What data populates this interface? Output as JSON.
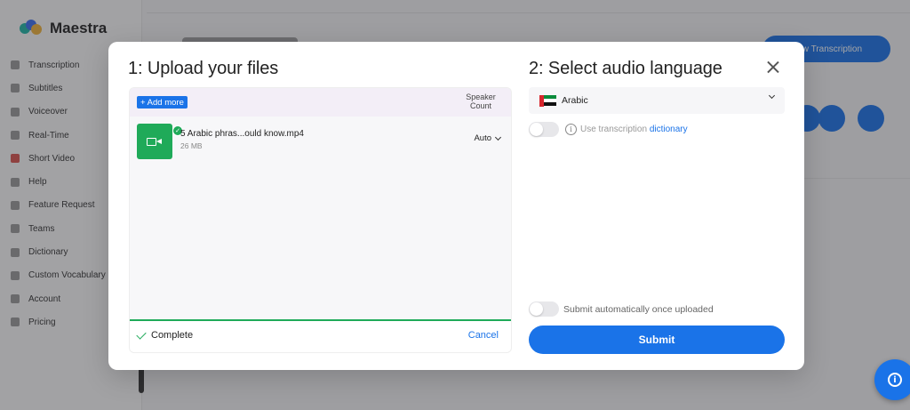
{
  "background": {
    "app_name": "Maestra",
    "nav_items": [
      "Transcription",
      "Subtitles",
      "Voiceover",
      "Real-Time",
      "Short Video",
      "Help",
      "Feature Request",
      "Teams",
      "Dictionary",
      "Custom Vocabulary",
      "Account",
      "Pricing"
    ],
    "new_button_label": "New Transcription"
  },
  "modal": {
    "upload_title": "1: Upload your files",
    "language_title": "2: Select audio language",
    "add_more_label": "+ Add more",
    "speaker_count_label": "Speaker Count",
    "file": {
      "name": "5 Arabic phras...ould know.mp4",
      "size": "26 MB",
      "speaker_count": "Auto"
    },
    "upload_status": "Complete",
    "upload_progress": 1.0,
    "cancel_label": "Cancel",
    "language": "Arabic",
    "dictionary_text": "Use transcription ",
    "dictionary_link": "dictionary",
    "auto_submit_label": "Submit automatically once uploaded",
    "submit_label": "Submit"
  },
  "colors": {
    "accent": "#1a73e8",
    "success": "#1faa59"
  }
}
